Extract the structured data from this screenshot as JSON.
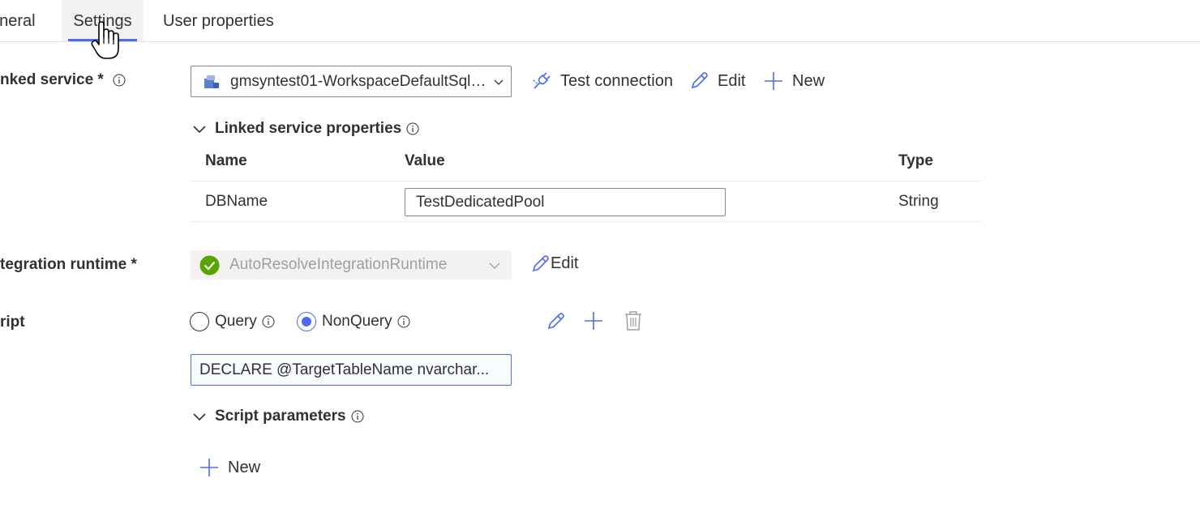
{
  "tabs": [
    {
      "label": "eneral"
    },
    {
      "label": "Settings",
      "active": true
    },
    {
      "label": "User properties"
    }
  ],
  "linked_service": {
    "label": "nked service",
    "required_mark": "*",
    "selected": "gmsyntest01-WorkspaceDefaultSqlS...",
    "actions": {
      "test": "Test connection",
      "edit": "Edit",
      "new": "New"
    }
  },
  "linked_service_properties": {
    "title": "Linked service properties",
    "columns": [
      "Name",
      "Value",
      "Type"
    ],
    "rows": [
      {
        "name": "DBName",
        "value": "TestDedicatedPool",
        "type": "String"
      }
    ]
  },
  "integration_runtime": {
    "label": "tegration runtime",
    "required_mark": "*",
    "selected": "AutoResolveIntegrationRuntime",
    "edit": "Edit"
  },
  "script": {
    "label": "ript",
    "options": [
      {
        "label": "Query",
        "selected": false
      },
      {
        "label": "NonQuery",
        "selected": true
      }
    ],
    "content": "DECLARE @TargetTableName nvarchar..."
  },
  "script_parameters": {
    "title": "Script parameters",
    "new": "New"
  },
  "colors": {
    "accent": "#4f6bed",
    "success": "#57a300",
    "text": "#323130",
    "disabled": "#a19f9d"
  }
}
